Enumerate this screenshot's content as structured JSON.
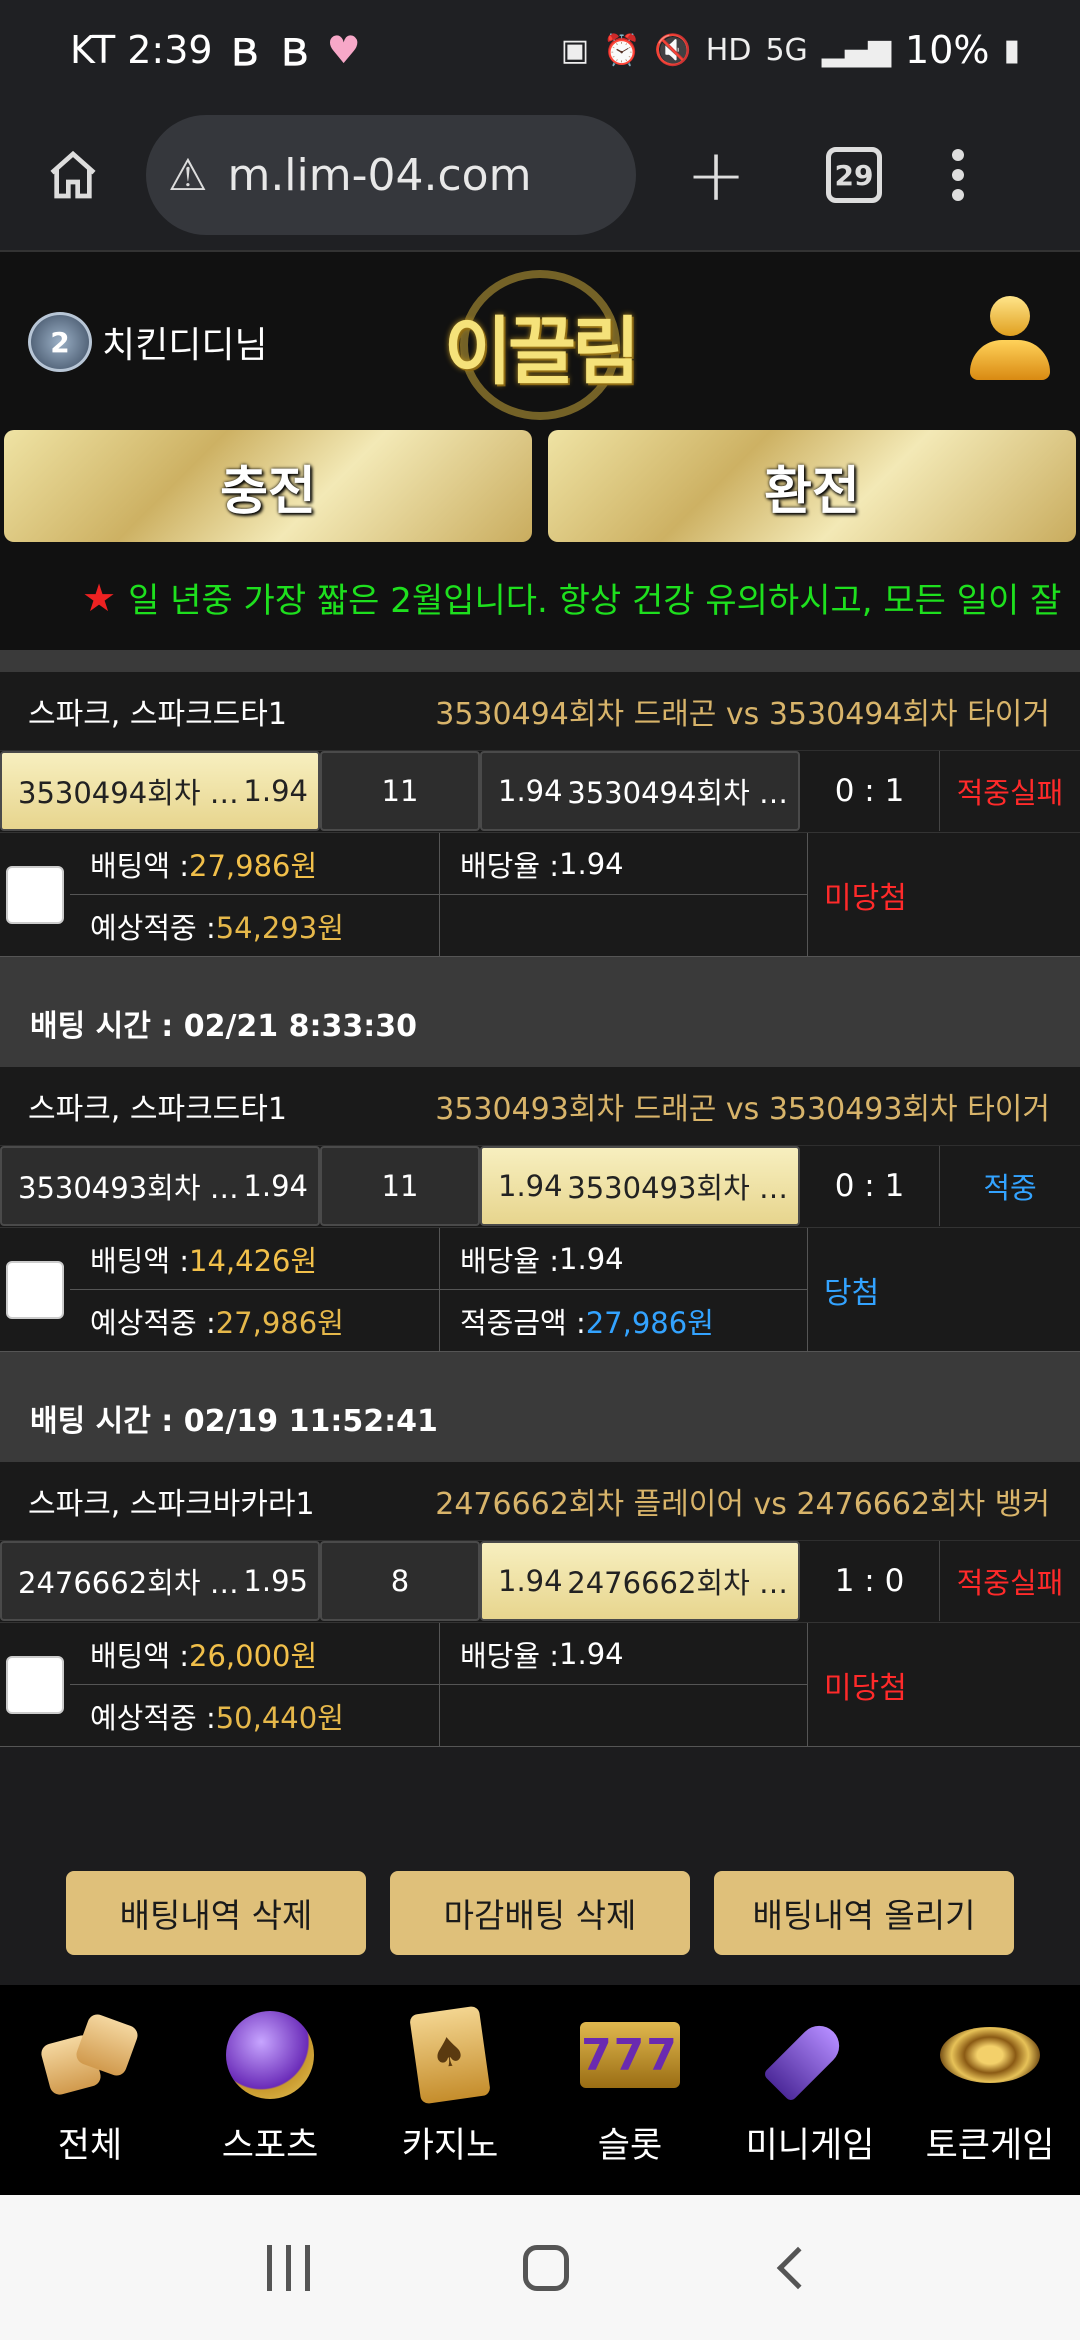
{
  "status_bar": {
    "carrier_time": "KT 2:39",
    "battery": "10%",
    "net": "5G"
  },
  "browser": {
    "url": "m.lim-04.com",
    "tab_count": "29"
  },
  "header": {
    "username": "치킨디디님",
    "rank": "2",
    "logo_text": "이끌림"
  },
  "cash": {
    "charge": "충전",
    "exchange": "환전"
  },
  "notice": "일 년중 가장 짧은 2월입니다. 항상 건강 유의하시고, 모든 일이 잘",
  "bets": [
    {
      "time_label": "",
      "game": "스파크, 스파크드타1",
      "match": "3530494회차 드래곤  vs  3530494회차 타이거",
      "home": "3530494회차 …",
      "home_odds": "1.94",
      "line": "11",
      "away_odds": "1.94",
      "away": "3530494회차 …",
      "score": "0 : 1",
      "result": "적중실패",
      "amount_label": "배팅액 : ",
      "amount": "27,986원",
      "rate_label": "배당율 : ",
      "rate": "1.94",
      "expected_label": "예상적중 : ",
      "expected": "54,293원",
      "win_label": "",
      "win": "",
      "status": "미당첨"
    },
    {
      "time_label": "배팅 시간 : 02/21 8:33:30",
      "game": "스파크, 스파크드타1",
      "match": "3530493회차 드래곤  vs  3530493회차 타이거",
      "home": "3530493회차 …",
      "home_odds": "1.94",
      "line": "11",
      "away_odds": "1.94",
      "away": "3530493회차 …",
      "score": "0 : 1",
      "result": "적중",
      "amount_label": "배팅액 : ",
      "amount": "14,426원",
      "rate_label": "배당율 : ",
      "rate": "1.94",
      "expected_label": "예상적중 : ",
      "expected": "27,986원",
      "win_label": "적중금액 : ",
      "win": "27,986원",
      "status": "당첨"
    },
    {
      "time_label": "배팅 시간 : 02/19 11:52:41",
      "game": "스파크, 스파크바카라1",
      "match": "2476662회차 플레이어  vs  2476662회차 뱅커",
      "home": "2476662회차 …",
      "home_odds": "1.95",
      "line": "8",
      "away_odds": "1.94",
      "away": "2476662회차 …",
      "score": "1 : 0",
      "result": "적중실패",
      "amount_label": "배팅액 : ",
      "amount": "26,000원",
      "rate_label": "배당율 : ",
      "rate": "1.94",
      "expected_label": "예상적중 : ",
      "expected": "50,440원",
      "win_label": "",
      "win": "",
      "status": "미당첨"
    }
  ],
  "actions": {
    "delete": "배팅내역 삭제",
    "delete_closed": "마감배팅 삭제",
    "upload": "배팅내역 올리기"
  },
  "nav": [
    "전체",
    "스포츠",
    "카지노",
    "슬롯",
    "미니게임",
    "토큰게임"
  ],
  "slot_text": "777",
  "colors": {
    "gold": "#dfc07a",
    "fail": "#ff2a2a",
    "hit": "#33a3ff",
    "notice": "#1ee01e"
  }
}
